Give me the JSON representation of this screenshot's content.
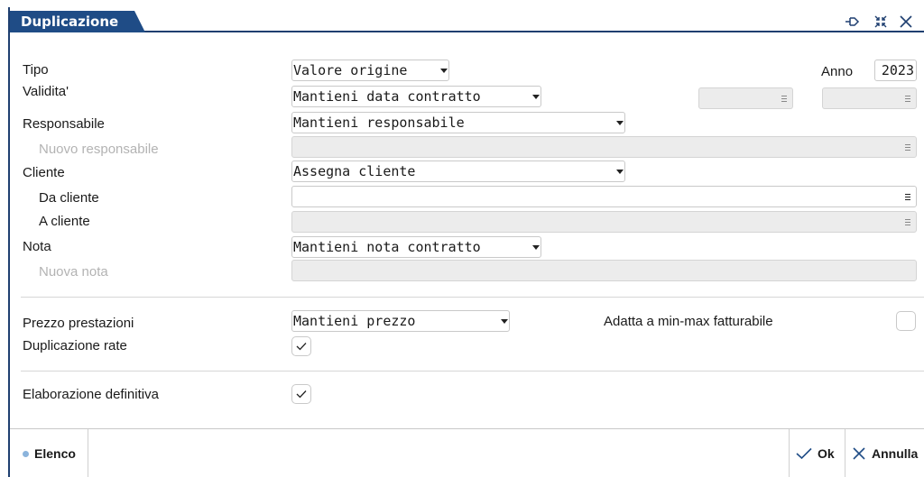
{
  "window": {
    "title": "Duplicazione"
  },
  "form": {
    "tipo": {
      "label": "Tipo",
      "value": "Valore origine"
    },
    "anno": {
      "label": "Anno",
      "value": "2023"
    },
    "validita": {
      "label": "Validita'",
      "value": "Mantieni data contratto"
    },
    "responsabile": {
      "label": "Responsabile",
      "value": "Mantieni responsabile"
    },
    "nuovo_responsabile": {
      "label": "Nuovo responsabile",
      "value": ""
    },
    "cliente": {
      "label": "Cliente",
      "value": "Assegna cliente"
    },
    "da_cliente": {
      "label": "Da cliente",
      "value": ""
    },
    "a_cliente": {
      "label": "A cliente",
      "value": ""
    },
    "nota": {
      "label": "Nota",
      "value": "Mantieni nota contratto"
    },
    "nuova_nota": {
      "label": "Nuova nota",
      "value": ""
    },
    "prezzo_prestazioni": {
      "label": "Prezzo prestazioni",
      "value": "Mantieni prezzo"
    },
    "adatta": {
      "label": "Adatta a min-max fatturabile",
      "checked": false
    },
    "duplicazione_rate": {
      "label": "Duplicazione rate",
      "checked": true
    },
    "elaborazione_definitiva": {
      "label": "Elaborazione definitiva",
      "checked": true
    }
  },
  "footer": {
    "elenco_label": "Elenco",
    "ok_label": "Ok",
    "annulla_label": "Annulla"
  },
  "icons": {
    "titlebar": [
      "pin-icon",
      "compress-icon",
      "close-icon"
    ],
    "footer": [
      "dot-icon",
      "check-icon",
      "x-icon"
    ]
  },
  "colors": {
    "accent": "#1f4c86",
    "border": "#1f3f70",
    "dot": "#8bb4dc"
  }
}
